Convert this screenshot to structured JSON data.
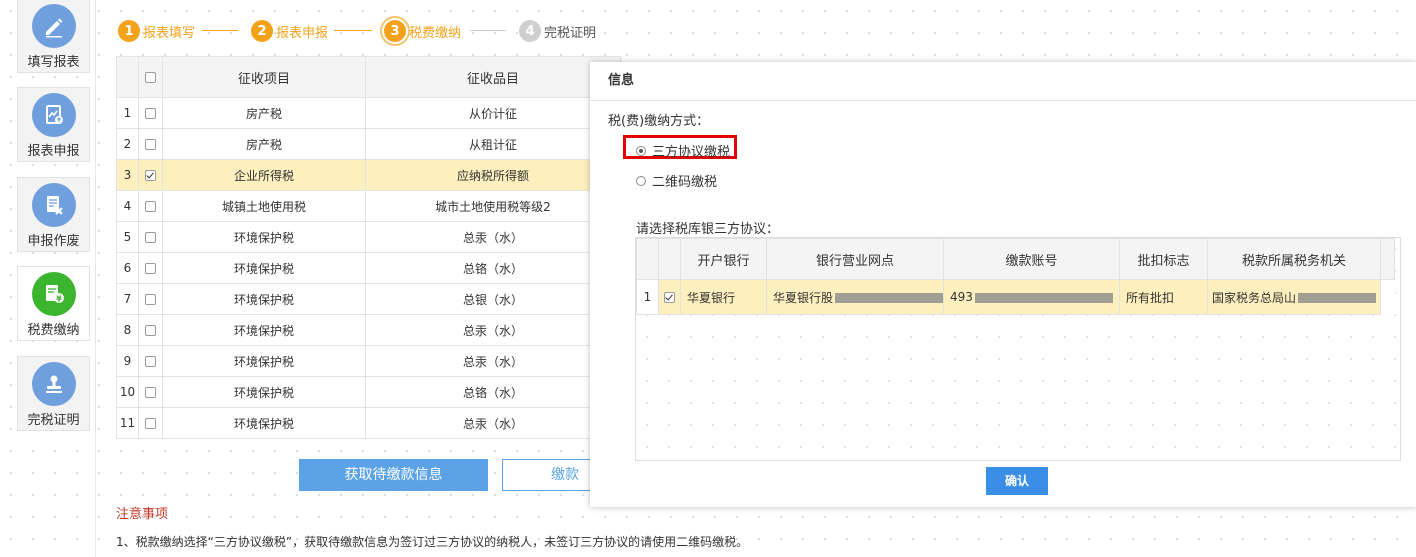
{
  "sidebar": {
    "items": [
      {
        "label": "填写报表",
        "icon": "edit-pencil-icon",
        "active": false
      },
      {
        "label": "报表申报",
        "icon": "report-chart-icon",
        "active": false
      },
      {
        "label": "申报作废",
        "icon": "document-cancel-icon",
        "active": false
      },
      {
        "label": "税费缴纳",
        "icon": "tax-payment-icon",
        "active": true
      },
      {
        "label": "完税证明",
        "icon": "stamp-icon",
        "active": false
      }
    ]
  },
  "stepper": {
    "steps": [
      {
        "num": "1",
        "label": "报表填写",
        "state": "done"
      },
      {
        "num": "2",
        "label": "报表申报",
        "state": "done"
      },
      {
        "num": "3",
        "label": "税费缴纳",
        "state": "current"
      },
      {
        "num": "4",
        "label": "完税证明",
        "state": "pending"
      }
    ]
  },
  "main_table": {
    "headers": [
      "",
      "征收项目",
      "征收品目"
    ],
    "rows": [
      {
        "no": "1",
        "checked": false,
        "item": "房产税",
        "sub": "从价计征"
      },
      {
        "no": "2",
        "checked": false,
        "item": "房产税",
        "sub": "从租计征"
      },
      {
        "no": "3",
        "checked": true,
        "item": "企业所得税",
        "sub": "应纳税所得额"
      },
      {
        "no": "4",
        "checked": false,
        "item": "城镇土地使用税",
        "sub": "城市土地使用税等级2"
      },
      {
        "no": "5",
        "checked": false,
        "item": "环境保护税",
        "sub": "总汞（水）"
      },
      {
        "no": "6",
        "checked": false,
        "item": "环境保护税",
        "sub": "总铬（水）"
      },
      {
        "no": "7",
        "checked": false,
        "item": "环境保护税",
        "sub": "总银（水）"
      },
      {
        "no": "8",
        "checked": false,
        "item": "环境保护税",
        "sub": "总汞（水）"
      },
      {
        "no": "9",
        "checked": false,
        "item": "环境保护税",
        "sub": "总汞（水）"
      },
      {
        "no": "10",
        "checked": false,
        "item": "环境保护税",
        "sub": "总铬（水）"
      },
      {
        "no": "11",
        "checked": false,
        "item": "环境保护税",
        "sub": "总汞（水）"
      }
    ]
  },
  "buttons": {
    "fetch": "获取待缴款信息",
    "pay": "缴款"
  },
  "notes": {
    "title": "注意事项",
    "line1": "1、税款缴纳选择“三方协议缴税”，获取待缴款信息为签订过三方协议的纳税人，未签订三方协议的请使用二维码缴税。"
  },
  "dialog": {
    "title": "信息",
    "pay_method_label": "税(费)缴纳方式：",
    "options": [
      {
        "label": "三方协议缴税",
        "selected": true
      },
      {
        "label": "二维码缴税",
        "selected": false
      }
    ],
    "agreement_label": "请选择税库银三方协议：",
    "agreement_table": {
      "headers": [
        "",
        "开户银行",
        "银行营业网点",
        "缴款账号",
        "批扣标志",
        "税款所属税务机关"
      ],
      "rows": [
        {
          "no": "1",
          "checked": true,
          "bank": "华夏银行",
          "branch": "华夏银行股",
          "account": "493",
          "flag": "所有批扣",
          "authority": "国家税务总局山"
        }
      ]
    },
    "confirm": "确认"
  },
  "colors": {
    "step_accent": "#f5a21b",
    "button_blue": "#5ba3e6",
    "selected_row": "#fdefbe",
    "highlight_red": "#e30000",
    "nav_icon_blue": "#6f9fdc",
    "nav_icon_green": "#3cb52e"
  }
}
